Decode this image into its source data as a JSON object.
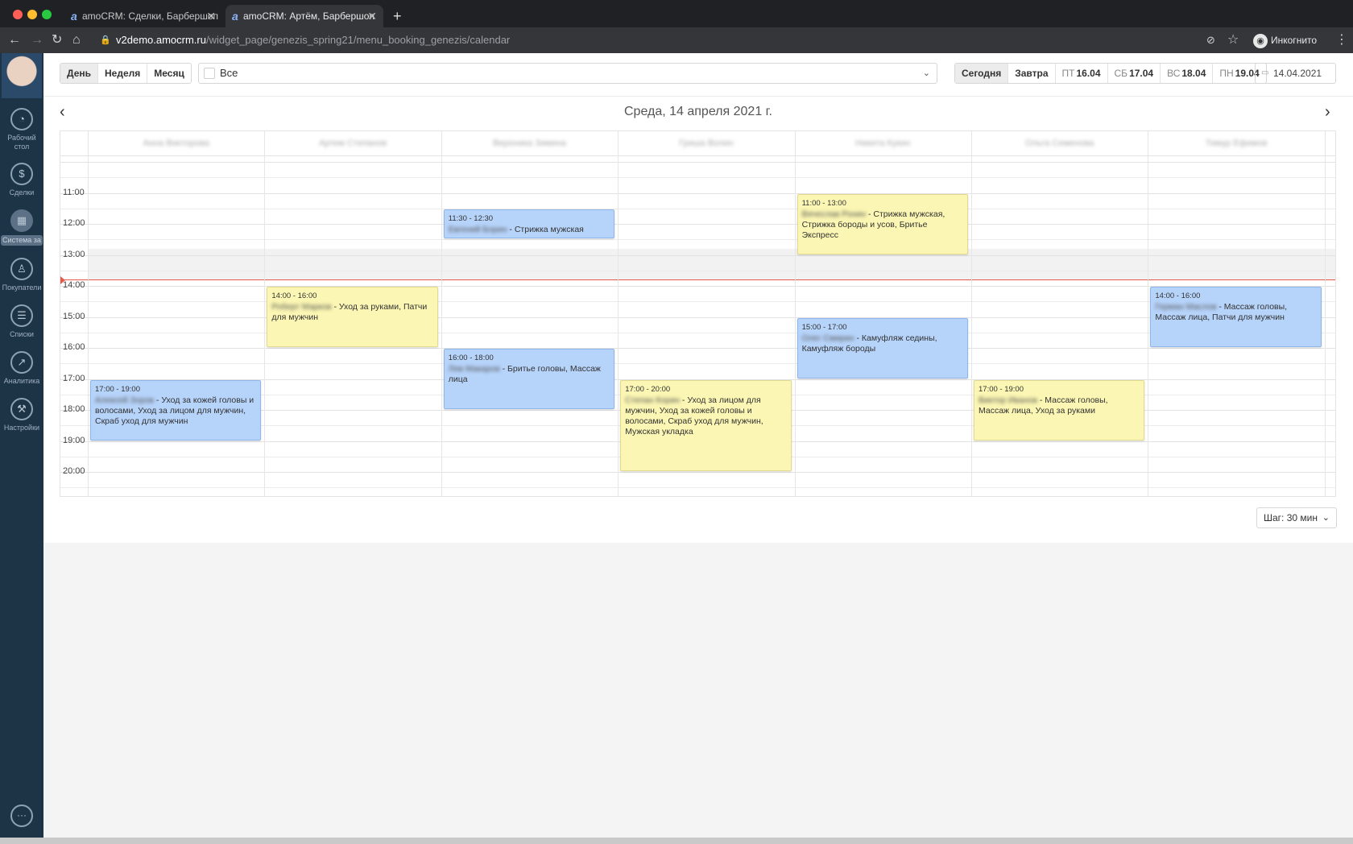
{
  "browser": {
    "tabs": [
      {
        "title": "amoCRM: Сделки, Барбершоп",
        "active": false
      },
      {
        "title": "amoCRM: Артём, Барбершоп",
        "active": true
      }
    ],
    "url_host": "v2demo.amocrm.ru",
    "url_path": "/widget_page/genezis_spring21/menu_booking_genezis/calendar",
    "incognito_label": "Инкогнито"
  },
  "sidebar": {
    "items": [
      {
        "label": "Рабочий стол",
        "icon": "speedometer-icon"
      },
      {
        "label": "Сделки",
        "icon": "dollar-icon"
      },
      {
        "label": "Система за",
        "icon": "calendar-icon",
        "active": true
      },
      {
        "label": "Покупатели",
        "icon": "customers-icon"
      },
      {
        "label": "Списки",
        "icon": "list-icon"
      },
      {
        "label": "Аналитика",
        "icon": "analytics-icon"
      },
      {
        "label": "Настройки",
        "icon": "wrench-icon"
      }
    ]
  },
  "toolbar": {
    "views": [
      {
        "label": "День",
        "active": true
      },
      {
        "label": "Неделя",
        "active": false
      },
      {
        "label": "Месяц",
        "active": false
      }
    ],
    "filter_value": "Все",
    "quick_dates": [
      {
        "label": "Сегодня",
        "active": true
      },
      {
        "label": "Завтра"
      },
      {
        "weekday": "ПТ",
        "date": "16.04"
      },
      {
        "weekday": "СБ",
        "date": "17.04"
      },
      {
        "weekday": "ВС",
        "date": "18.04"
      },
      {
        "weekday": "ПН",
        "date": "19.04"
      }
    ],
    "date_value": "14.04.2021"
  },
  "calendar": {
    "title": "Среда, 14 апреля 2021 г.",
    "staff": [
      "Анна Викторова",
      "Артем Степанов",
      "Вероника Зимина",
      "Гриша Волин",
      "Никита Кукин",
      "Ольга Семенова",
      "Тимур Ефимов"
    ],
    "times": [
      "11:00",
      "12:00",
      "13:00",
      "14:00",
      "15:00",
      "16:00",
      "17:00",
      "18:00",
      "19:00",
      "20:00"
    ],
    "events": [
      {
        "col": 2,
        "start": 11.5,
        "end": 12.5,
        "color": "blue",
        "time": "11:30 - 12:30",
        "client": "Евгений Борин",
        "services": " - Стрижка мужская"
      },
      {
        "col": 4,
        "start": 11,
        "end": 13,
        "color": "yellow",
        "time": "11:00 - 13:00",
        "client": "Вячеслав Ронин",
        "services": " - Стрижка мужская, Стрижка бороды и усов, Бритье Экспресс"
      },
      {
        "col": 1,
        "start": 14,
        "end": 16,
        "color": "yellow",
        "time": "14:00 - 16:00",
        "client": "Роберт Марков",
        "services": " - Уход за руками, Патчи для мужчин"
      },
      {
        "col": 6,
        "start": 14,
        "end": 16,
        "color": "blue",
        "time": "14:00 - 16:00",
        "client": "Герман Маслов",
        "services": " - Массаж головы, Массаж лица, Патчи для мужчин"
      },
      {
        "col": 4,
        "start": 15,
        "end": 17,
        "color": "blue",
        "time": "15:00 - 17:00",
        "client": "Олег Смирин",
        "services": " - Камуфляж седины, Камуфляж бороды"
      },
      {
        "col": 2,
        "start": 16,
        "end": 18,
        "color": "blue",
        "time": "16:00 - 18:00",
        "client": "Лев Макаров",
        "services": " - Бритье головы, Массаж лица"
      },
      {
        "col": 0,
        "start": 17,
        "end": 19,
        "color": "blue",
        "time": "17:00 - 19:00",
        "client": "Алексей Зоров",
        "services": " - Уход за кожей головы и волосами, Уход за лицом для мужчин, Скраб уход для мужчин"
      },
      {
        "col": 3,
        "start": 17,
        "end": 20,
        "color": "yellow",
        "time": "17:00 - 20:00",
        "client": "Степан Корин",
        "services": " - Уход за лицом для мужчин, Уход за кожей головы и волосами, Скраб уход для мужчин, Мужская укладка"
      },
      {
        "col": 5,
        "start": 17,
        "end": 19,
        "color": "yellow",
        "time": "17:00 - 19:00",
        "client": "Виктор Иванов",
        "services": " - Массаж головы, Массаж лица, Уход за руками"
      }
    ],
    "step_label": "Шаг: 30 мин"
  }
}
